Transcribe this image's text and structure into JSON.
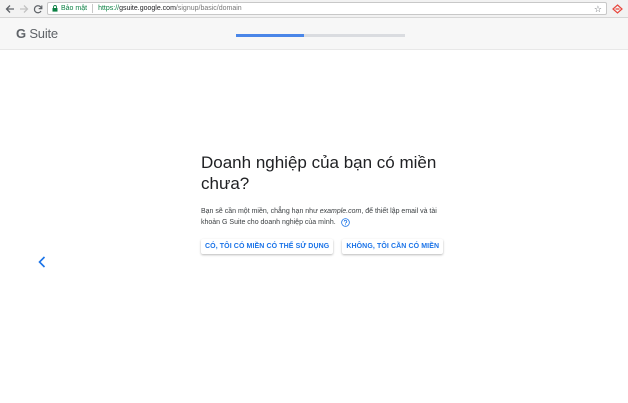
{
  "browser": {
    "secure_label": "Bảo mật",
    "url_scheme": "https://",
    "url_host": "gsuite.google.com",
    "url_path": "/signup/basic/domain"
  },
  "header": {
    "logo_g": "G",
    "logo_suite": " Suite",
    "progress_fraction": 0.4
  },
  "main": {
    "title": "Doanh nghiệp của bạn có miền chưa?",
    "desc_part1": "Bạn sẽ cần một miền, chẳng hạn như ",
    "desc_example": "example.com",
    "desc_part2": ", để thiết lập email và tài khoản G Suite cho doanh nghiệp của mình.",
    "btn_yes": "CÓ, TÔI CÓ MIỀN CÓ THỂ SỬ DỤNG",
    "btn_no": "KHÔNG, TÔI CẦN CÓ MIỀN"
  },
  "colors": {
    "accent": "#1a73e8",
    "progress": "#4a86e8",
    "secure": "#0b8043"
  }
}
